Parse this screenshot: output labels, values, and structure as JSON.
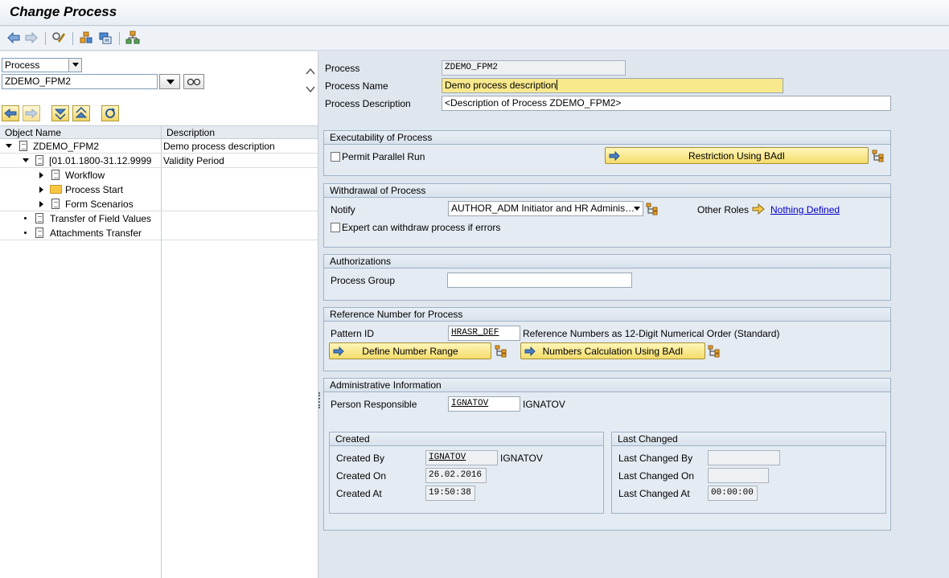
{
  "window": {
    "title": "Change Process"
  },
  "toolbar": {
    "icons": [
      "back-arrow-icon",
      "forward-arrow-icon",
      "display-change-icon",
      "tree-icon",
      "copy-icon",
      "hierarchy-icon"
    ]
  },
  "left": {
    "object_type": "Process",
    "object_value": "ZDEMO_FPM2",
    "columns": {
      "name": "Object Name",
      "description": "Description"
    },
    "tree": [
      {
        "name": "ZDEMO_FPM2",
        "description": "Demo process description"
      },
      {
        "name": "[01.01.1800-31.12.9999",
        "description": "Validity Period"
      },
      {
        "name": "Workflow",
        "description": ""
      },
      {
        "name": "Process Start",
        "description": ""
      },
      {
        "name": "Form Scenarios",
        "description": ""
      },
      {
        "name": "Transfer of Field Values",
        "description": ""
      },
      {
        "name": "Attachments Transfer",
        "description": ""
      }
    ]
  },
  "header": {
    "process_label": "Process",
    "process_value": "ZDEMO_FPM2",
    "process_name_label": "Process Name",
    "process_name_value": "Demo process description",
    "process_desc_label": "Process Description",
    "process_desc_value": "<Description of Process ZDEMO_FPM2>"
  },
  "executability": {
    "title": "Executability of Process",
    "permit_parallel_run": "Permit Parallel Run",
    "restriction_button": "Restriction Using BAdI"
  },
  "withdrawal": {
    "title": "Withdrawal of Process",
    "notify_label": "Notify",
    "notify_value": "AUTHOR_ADM Initiator and HR Adminis…",
    "other_roles_label": "Other Roles",
    "other_roles_link": "Nothing Defined",
    "expert_withdraw": "Expert can withdraw process if errors"
  },
  "authorizations": {
    "title": "Authorizations",
    "process_group_label": "Process Group",
    "process_group_value": ""
  },
  "reference": {
    "title": "Reference Number for Process",
    "pattern_label": "Pattern ID",
    "pattern_value": "HRASR_DEF",
    "pattern_desc": "Reference Numbers as 12-Digit Numerical Order (Standard)",
    "define_button": "Define Number Range",
    "calc_button": "Numbers Calculation Using BAdI"
  },
  "admin": {
    "title": "Administrative Information",
    "person_label": "Person Responsible",
    "person_value": "IGNATOV",
    "person_name": "IGNATOV",
    "created": {
      "title": "Created",
      "by_label": "Created By",
      "by_value": "IGNATOV",
      "by_name": "IGNATOV",
      "on_label": "Created On",
      "on_value": "26.02.2016",
      "at_label": "Created At",
      "at_value": "19:50:38"
    },
    "changed": {
      "title": "Last Changed",
      "by_label": "Last Changed By",
      "by_value": "",
      "on_label": "Last Changed On",
      "on_value": "",
      "at_label": "Last Changed At",
      "at_value": "00:00:00"
    }
  },
  "colors": {
    "button_yellow": "#f4dc6c",
    "highlight": "#f9e98d",
    "panel": "#e4ebf2",
    "link": "#0000cc"
  }
}
